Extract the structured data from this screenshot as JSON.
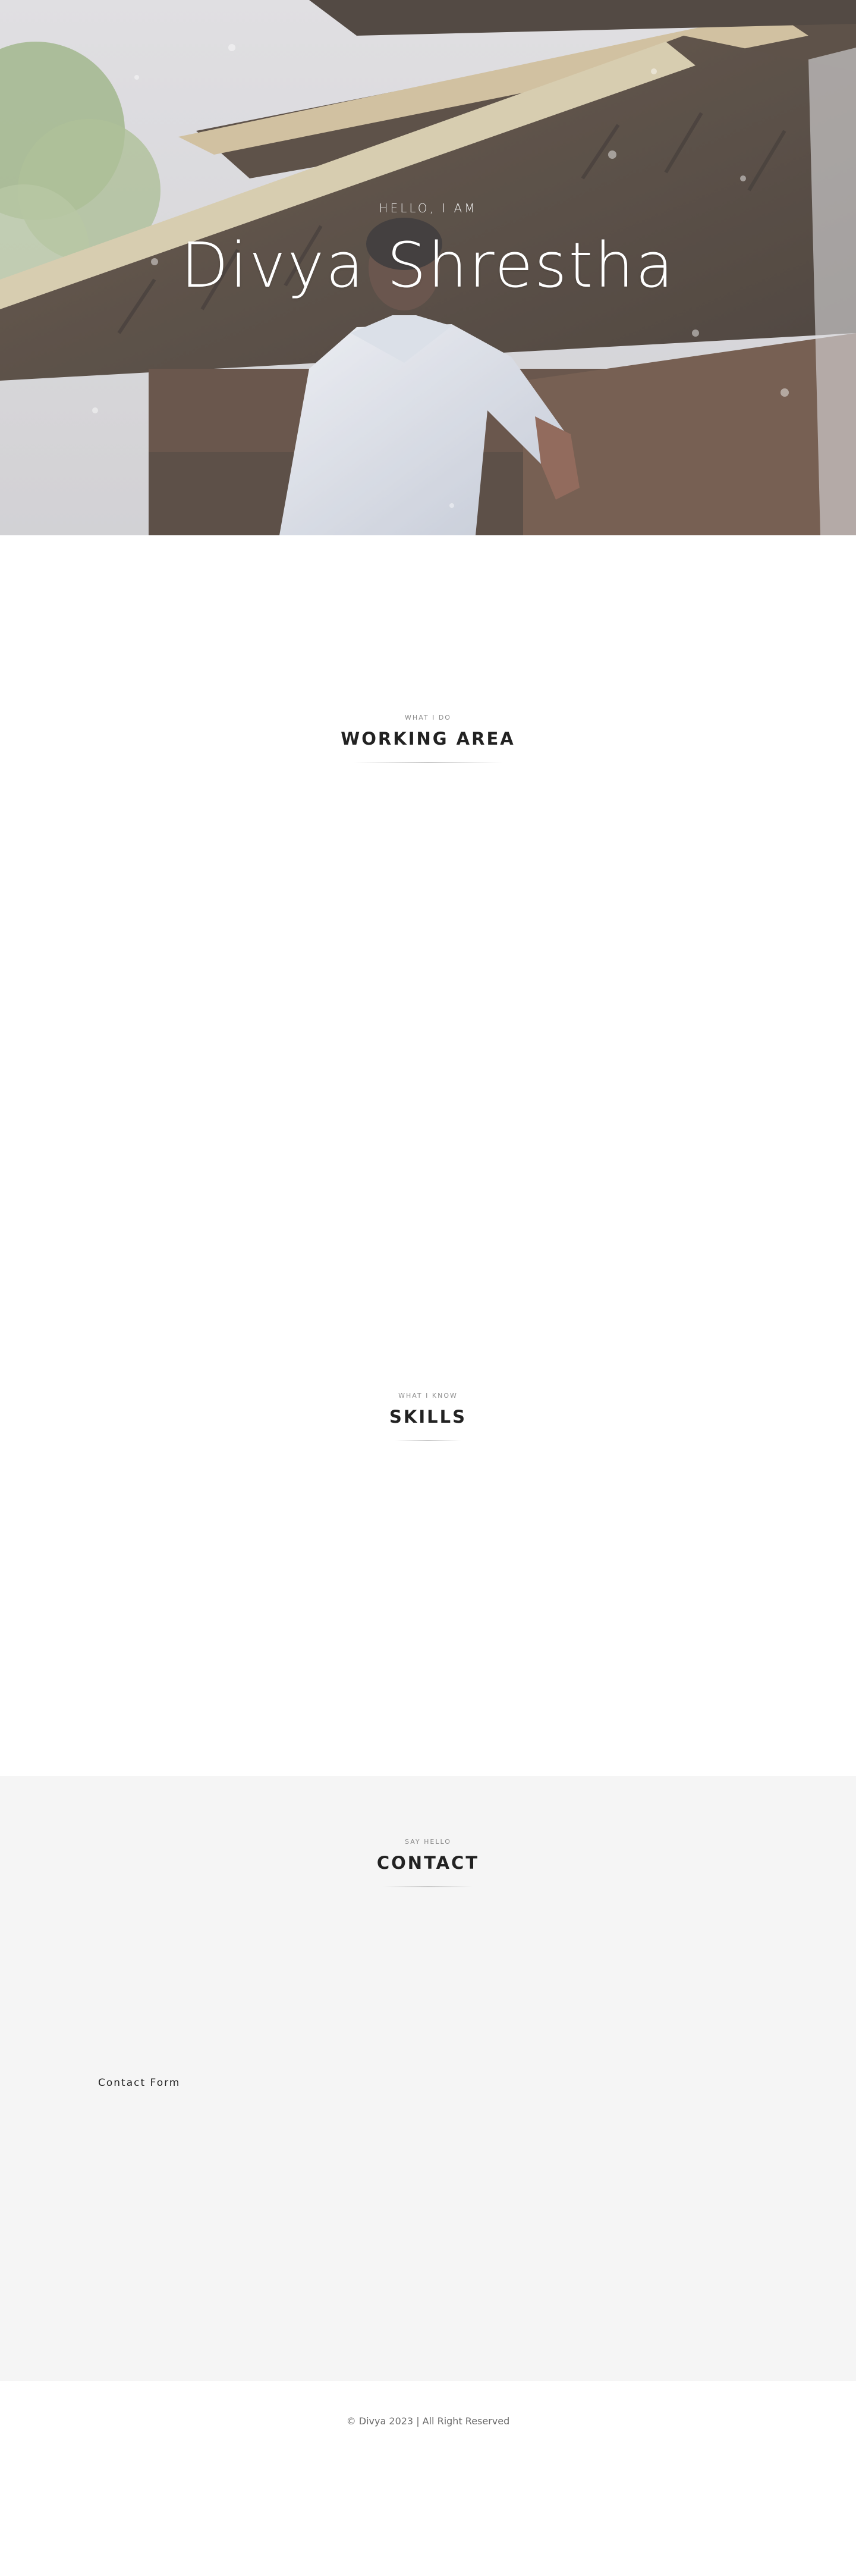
{
  "hero": {
    "greeting": "HELLO, I AM",
    "name": "Divya Shrestha"
  },
  "sections": {
    "working": {
      "kicker": "WHAT I DO",
      "title": "WORKING AREA"
    },
    "skills": {
      "kicker": "WHAT I KNOW",
      "title": "SKILLS"
    },
    "contact": {
      "kicker": "SAY HELLO",
      "title": "CONTACT",
      "form_label": "Contact Form"
    }
  },
  "footer": {
    "copyright": "© Divya 2023 | All Right Reserved"
  }
}
